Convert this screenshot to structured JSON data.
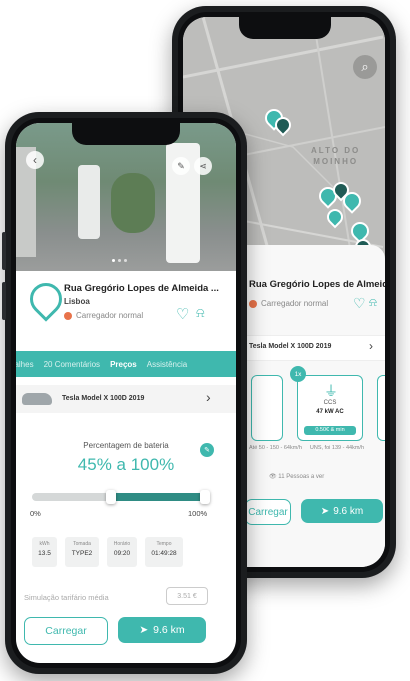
{
  "back": {
    "map_labels": [
      "ALTO DO",
      "MOINHO"
    ],
    "station": {
      "title": "Rua Gregório Lopes de Almeida ...",
      "type": "Carregador normal",
      "car": "Tesla Model X 100D 2019",
      "connectors": [
        {
          "badge": "1x",
          "code": "CCS",
          "power": "47 kW AC",
          "status": "0.50€ & min"
        }
      ],
      "meta": [
        "Até 50 - 150 - 64km/h",
        "UNS, foi 139 - 44km/h"
      ],
      "people": "11 Pessoas a ver",
      "charge_label": "Carregar",
      "distance": "9.6 km"
    }
  },
  "front": {
    "station": {
      "title": "Rua Gregório Lopes de Almeida ...",
      "city": "Lisboa",
      "type": "Carregador normal"
    },
    "tabs": [
      "Detalhes",
      "20 Comentários",
      "Preços",
      "Assistência"
    ],
    "active_tab": "Preços",
    "car": "Tesla Model X 100D 2019",
    "battery": {
      "title": "Percentagem de bateria",
      "range": "45% a 100%",
      "start": 0.45,
      "end": 1.0,
      "min_label": "0%",
      "max_label": "100%"
    },
    "stats": [
      {
        "label": "kWh",
        "value": "13.5"
      },
      {
        "label": "Tomada",
        "value": "TYPE2"
      },
      {
        "label": "Horário",
        "value": "09:20"
      },
      {
        "label": "Tempo",
        "value": "01:49:28"
      }
    ],
    "simulation": {
      "label": "Simulação tarifário média",
      "value": "3.51 €"
    },
    "charge_label": "Carregar",
    "distance": "9.6 km"
  },
  "colors": {
    "accent": "#3fb8ae",
    "dark": "#222222",
    "alert": "#e8734a"
  }
}
